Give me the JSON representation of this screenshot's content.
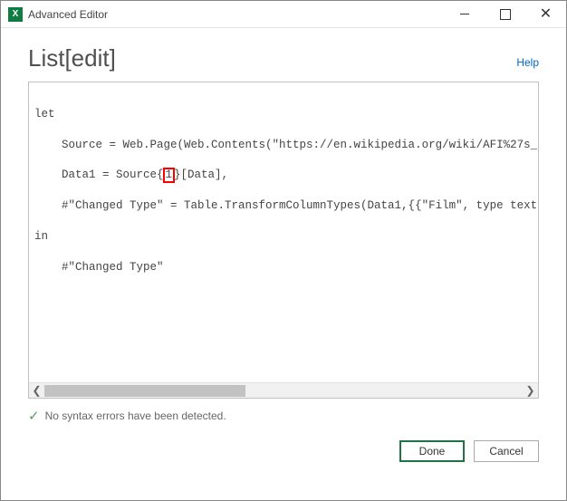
{
  "window": {
    "title": "Advanced Editor"
  },
  "header": {
    "page_title": "List[edit]",
    "help_label": "Help"
  },
  "code": {
    "line1": "let",
    "line2_pre": "Source = Web.Page(Web.Contents(\"https://en.wikipedia.org/wiki/AFI%27s_100_Years..",
    "line3_pre": "Data1 = Source{",
    "line3_highlight": "1",
    "line3_post": "}[Data],",
    "line4": "#\"Changed Type\" = Table.TransformColumnTypes(Data1,{{\"Film\", type text}, {\"Releas",
    "line5": "in",
    "line6": "#\"Changed Type\""
  },
  "status": {
    "message": "No syntax errors have been detected."
  },
  "buttons": {
    "done": "Done",
    "cancel": "Cancel"
  }
}
